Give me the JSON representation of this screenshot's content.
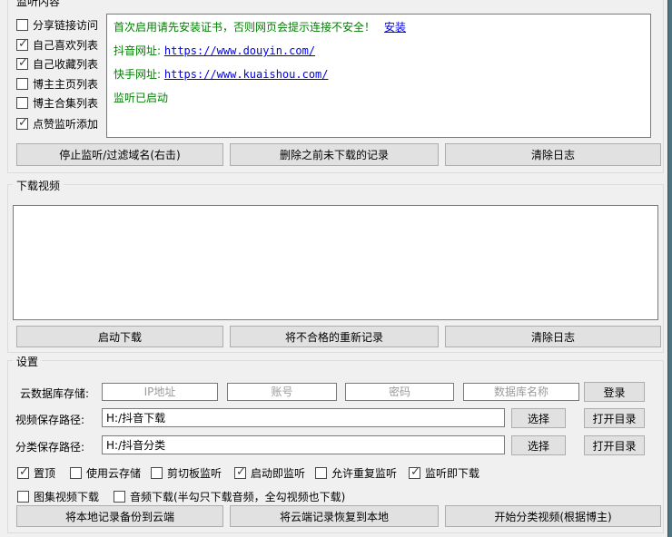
{
  "colors": {
    "window_bg": "#f0f0f0",
    "log_green": "#008000",
    "link_blue": "#0000ee",
    "button_bg": "#e1e1e1",
    "desktop_strip": "#4d7380"
  },
  "listen_group": {
    "title": "监听内容",
    "checkboxes": [
      {
        "label": "分享链接访问",
        "checked": false
      },
      {
        "label": "自己喜欢列表",
        "checked": true
      },
      {
        "label": "自己收藏列表",
        "checked": true
      },
      {
        "label": "博主主页列表",
        "checked": false
      },
      {
        "label": "博主合集列表",
        "checked": false
      },
      {
        "label": "点赞监听添加",
        "checked": true
      }
    ],
    "log": {
      "install_notice": "首次启用请先安装证书，否则网页会提示连接不安全！",
      "install_link": "安装",
      "douyin_label": "抖音网址:",
      "douyin_url": "https://www.douyin.com/",
      "kuaishou_label": "快手网址:",
      "kuaishou_url": "https://www.kuaishou.com/",
      "status": "监听已启动"
    },
    "buttons": {
      "stop": "停止监听/过滤域名(右击)",
      "delete_undownloaded": "删除之前未下载的记录",
      "clear_log": "清除日志"
    }
  },
  "download_group": {
    "title": "下载视频",
    "buttons": {
      "start": "启动下载",
      "requeue": "将不合格的重新记录",
      "clear_log": "清除日志"
    }
  },
  "settings_group": {
    "title": "设置",
    "cloud_row": {
      "label": "云数据库存储:",
      "ip_placeholder": "IP地址",
      "account_placeholder": "账号",
      "password_placeholder": "密码",
      "dbname_placeholder": "数据库名称",
      "login": "登录"
    },
    "video_path": {
      "label": "视频保存路径:",
      "value": "H:/抖音下载",
      "choose": "选择",
      "open": "打开目录"
    },
    "classify_path": {
      "label": "分类保存路径:",
      "value": "H:/抖音分类",
      "choose": "选择",
      "open": "打开目录"
    },
    "options_row1": [
      {
        "label": "置顶",
        "checked": true
      },
      {
        "label": "使用云存储",
        "checked": false
      },
      {
        "label": "剪切板监听",
        "checked": false
      },
      {
        "label": "启动即监听",
        "checked": true
      },
      {
        "label": "允许重复监听",
        "checked": false
      },
      {
        "label": "监听即下载",
        "checked": true
      }
    ],
    "options_row2": [
      {
        "label": "图集视频下载",
        "checked": false
      },
      {
        "label": "音频下载(半勾只下载音频，全勾视频也下载)",
        "checked": false
      }
    ],
    "buttons": {
      "backup": "将本地记录备份到云端",
      "restore": "将云端记录恢复到本地",
      "classify": "开始分类视频(根据博主)"
    }
  }
}
